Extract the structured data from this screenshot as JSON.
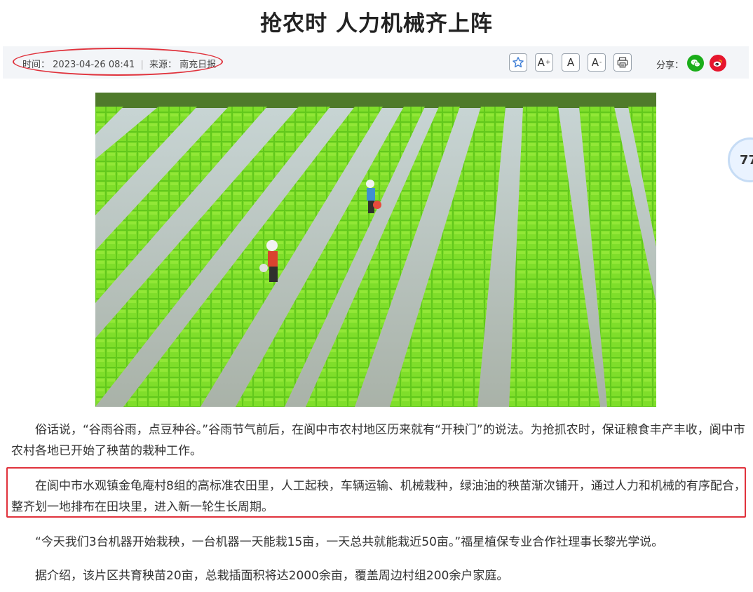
{
  "article": {
    "title": "抢农时 人力机械齐上阵",
    "meta": {
      "time_label": "时间：",
      "time_value": "2023-04-26 08:41",
      "source_label": "来源：",
      "source_value": "南充日报"
    },
    "toolbar": {
      "favorite_icon": "star-icon",
      "font_increase_label": "A",
      "font_normal_label": "A",
      "font_decrease_label": "A",
      "print_icon": "printer-icon"
    },
    "share": {
      "label": "分享：",
      "wechat_icon": "wechat-icon",
      "weibo_icon": "weibo-icon"
    },
    "photo_alt": "rice-seedling-field-photo",
    "float_badge": "77",
    "paragraphs": [
      "俗话说，“谷雨谷雨，点豆种谷。”谷雨节气前后，在阆中市农村地区历来就有“开秧门”的说法。为抢抓农时，保证粮食丰产丰收，阆中市农村各地已开始了秧苗的栽种工作。",
      "在阆中市水观镇金龟庵村8组的高标准农田里，人工起秧，车辆运输、机械栽种，绿油油的秧苗渐次铺开，通过人力和机械的有序配合，整齐划一地排布在田块里，进入新一轮生长周期。",
      "“今天我们3台机器开始栽秧，一台机器一天能栽15亩，一天总共就能栽近50亩。”福星植保专业合作社理事长黎光学说。",
      "据介绍，该片区共育秧苗20亩，总栽插面积将达2000余亩，覆盖周边村组200余户家庭。"
    ]
  },
  "colors": {
    "highlight_red": "#e0323c",
    "wechat_green": "#1aad19",
    "weibo_red": "#e6162d",
    "seedling_green": "#6cd41e"
  }
}
